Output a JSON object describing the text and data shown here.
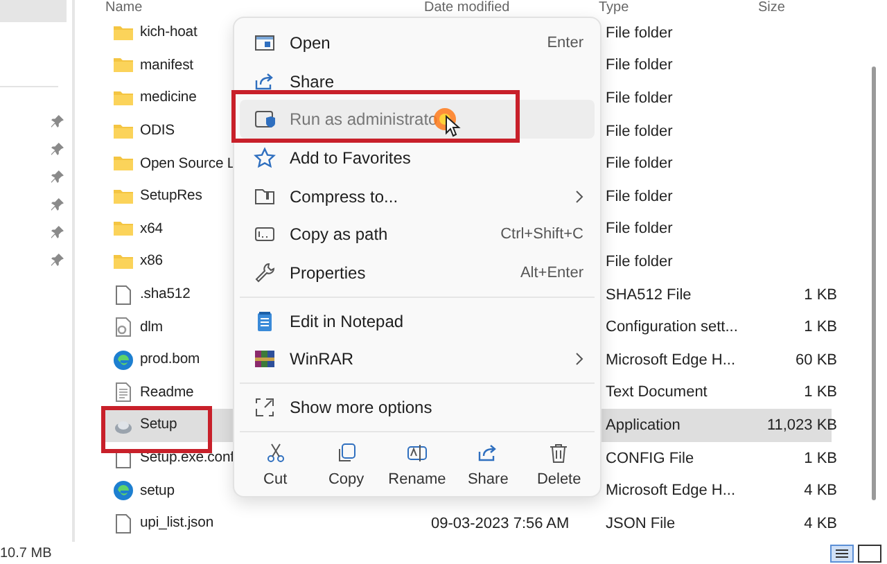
{
  "columns": [
    "Name",
    "Date modified",
    "Type",
    "Size"
  ],
  "rows": [
    {
      "name": "kich-hoat",
      "kind": "folder",
      "type": "File folder",
      "size": "",
      "selected": false
    },
    {
      "name": "manifest",
      "kind": "folder",
      "type": "File folder",
      "size": "",
      "selected": false
    },
    {
      "name": "medicine",
      "kind": "folder",
      "type": "File folder",
      "size": "",
      "selected": false
    },
    {
      "name": "ODIS",
      "kind": "folder",
      "type": "File folder",
      "size": "",
      "selected": false
    },
    {
      "name": "Open Source L",
      "kind": "folder",
      "type": "File folder",
      "size": "",
      "selected": false
    },
    {
      "name": "SetupRes",
      "kind": "folder",
      "type": "File folder",
      "size": "",
      "selected": false
    },
    {
      "name": "x64",
      "kind": "folder",
      "type": "File folder",
      "size": "",
      "selected": false
    },
    {
      "name": "x86",
      "kind": "folder",
      "type": "File folder",
      "size": "",
      "selected": false
    },
    {
      "name": ".sha512",
      "kind": "file",
      "type": "SHA512 File",
      "size": "1 KB",
      "selected": false
    },
    {
      "name": "dlm",
      "kind": "config",
      "type": "Configuration sett...",
      "size": "1 KB",
      "selected": false
    },
    {
      "name": "prod.bom",
      "kind": "edge",
      "type": "Microsoft Edge H...",
      "size": "60 KB",
      "selected": false
    },
    {
      "name": "Readme",
      "kind": "text",
      "type": "Text Document",
      "size": "1 KB",
      "selected": false
    },
    {
      "name": "Setup",
      "kind": "app",
      "type": "Application",
      "size": "11,023 KB",
      "selected": true
    },
    {
      "name": "Setup.exe.conf",
      "kind": "file",
      "type": "CONFIG File",
      "size": "1 KB",
      "selected": false
    },
    {
      "name": "setup",
      "kind": "edge",
      "type": "Microsoft Edge H...",
      "size": "4 KB",
      "selected": false
    },
    {
      "name": "upi_list.json",
      "kind": "file",
      "date": "09-03-2023 7:56 AM",
      "type": "JSON File",
      "size": "4 KB",
      "selected": false
    }
  ],
  "context_menu": {
    "groups": [
      [
        {
          "label": "Open",
          "kind": "open",
          "shortcut": "Enter",
          "submenu": false,
          "selected": false
        },
        {
          "label": "Share",
          "kind": "share",
          "submenu": false,
          "selected": false
        },
        {
          "label": "Run as administrato",
          "kind": "shield",
          "submenu": false,
          "selected": true
        },
        {
          "label": "Add to Favorites",
          "kind": "star",
          "submenu": false,
          "selected": false
        },
        {
          "label": "Compress to...",
          "kind": "zip",
          "submenu": true,
          "selected": false
        },
        {
          "label": "Copy as path",
          "kind": "path",
          "shortcut": "Ctrl+Shift+C",
          "submenu": false,
          "selected": false
        },
        {
          "label": "Properties",
          "kind": "wrench",
          "shortcut": "Alt+Enter",
          "submenu": false,
          "selected": false
        }
      ],
      [
        {
          "label": "Edit in Notepad",
          "kind": "notepad",
          "submenu": false,
          "selected": false
        },
        {
          "label": "WinRAR",
          "kind": "winrar",
          "submenu": true,
          "selected": false
        }
      ],
      [
        {
          "label": "Show more options",
          "kind": "expand",
          "submenu": false,
          "selected": false
        }
      ]
    ],
    "actions": [
      {
        "label": "Cut",
        "kind": "cut"
      },
      {
        "label": "Copy",
        "kind": "copy"
      },
      {
        "label": "Rename",
        "kind": "rename"
      },
      {
        "label": "Share",
        "kind": "share"
      },
      {
        "label": "Delete",
        "kind": "delete"
      }
    ]
  },
  "status_bar": {
    "text": "10.7 MB"
  },
  "view_buttons": [
    {
      "kind": "details",
      "selected": true
    },
    {
      "kind": "tiles",
      "selected": false
    }
  ]
}
